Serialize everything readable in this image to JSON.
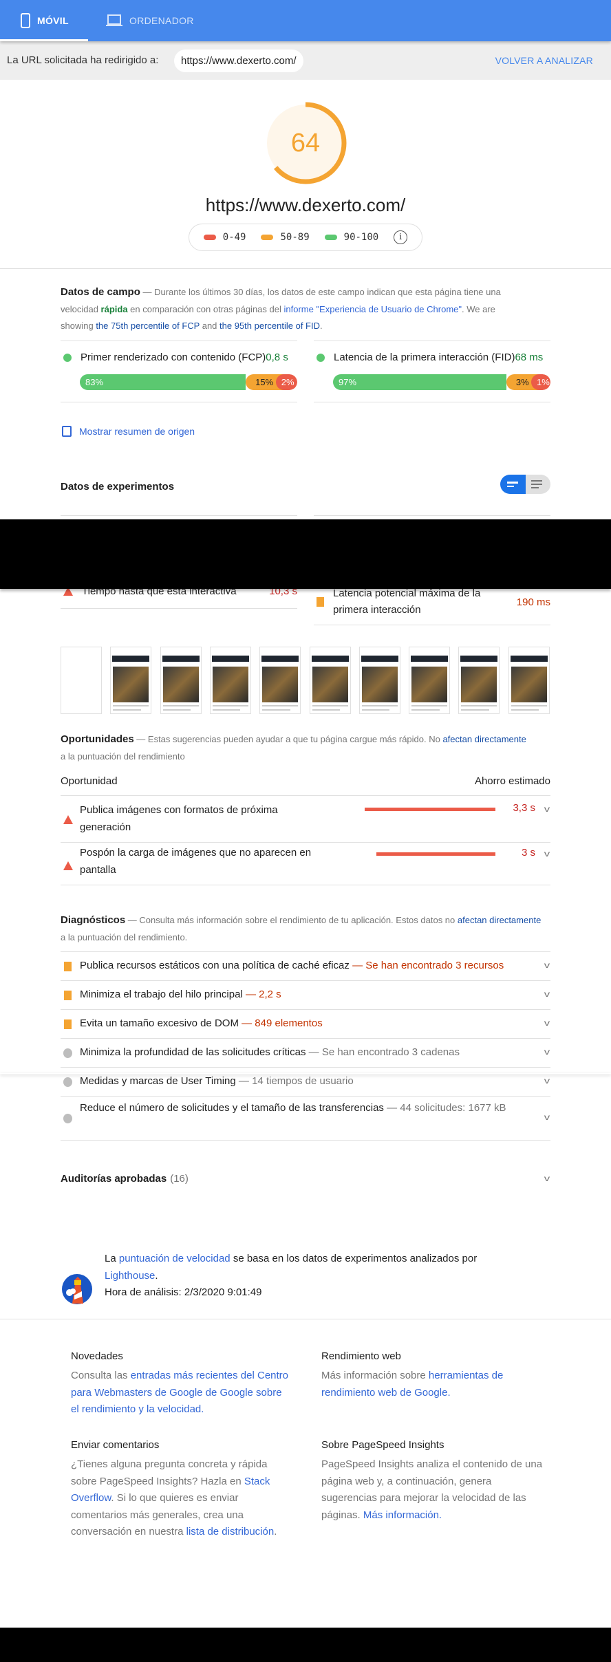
{
  "tabs": [
    {
      "label": "MÓVIL",
      "icon": "phone-icon",
      "active": true
    },
    {
      "label": "ORDENADOR",
      "icon": "laptop-icon",
      "active": false
    }
  ],
  "redirect": {
    "label": "La URL solicitada ha redirigido a:",
    "url": "https://www.dexerto.com/",
    "reanalyze": "VOLVER A ANALIZAR"
  },
  "score": {
    "value": "64",
    "fraction": 0.64,
    "color": "#f4a432",
    "url": "https://www.dexerto.com/"
  },
  "legend": [
    {
      "range": "0-49",
      "color": "#eb5b48"
    },
    {
      "range": "50-89",
      "color": "#f4a432"
    },
    {
      "range": "90-100",
      "color": "#5bc870"
    }
  ],
  "field": {
    "title": "Datos de campo",
    "desc_1": " — Durante los últimos 30 días, los datos de este campo indican que esta página tiene una velocidad ",
    "speed": "rápida",
    "desc_2": " en comparación con otras páginas del ",
    "report_link": "informe \"Experiencia de Usuario de Chrome\"",
    "desc_3": ". We are showing ",
    "fcp_link": "the 75th percentile of FCP",
    "desc_4": " and ",
    "fid_link": "the 95th percentile of FID",
    "desc_5": ".",
    "metrics": [
      {
        "name": "Primer renderizado con contenido (FCP)",
        "value": "0,8 s",
        "dist": [
          {
            "label": "83%",
            "pct": 83
          },
          {
            "label": "15%",
            "pct": 15
          },
          {
            "label": "2%",
            "pct": 2
          }
        ]
      },
      {
        "name": "Latencia de la primera interacción (FID)",
        "value": "68 ms",
        "dist": [
          {
            "label": "97%",
            "pct": 97
          },
          {
            "label": "3%",
            "pct": 3
          },
          {
            "label": "1%",
            "pct": 1
          }
        ]
      }
    ],
    "origin_checkbox": "Mostrar resumen de origen"
  },
  "lab": {
    "title": "Datos de experimentos",
    "metrics": [
      {
        "name": "Tiempo hasta que está interactiva",
        "value": "10,3 s"
      },
      {
        "name": "Latencia potencial máxima de la primera interacción",
        "value": "190 ms"
      }
    ]
  },
  "opportunities": {
    "title": "Oportunidades",
    "desc_1": " — Estas sugerencias pueden ayudar a que tu página cargue más rápido. No ",
    "link": "afectan directamente",
    "desc_2": " a la puntuación del rendimiento",
    "col_left": "Oportunidad",
    "col_right": "Ahorro estimado",
    "items": [
      {
        "title": "Publica imágenes con formatos de próxima generación",
        "saving": "3,3 s",
        "bar_fraction": 1.0
      },
      {
        "title": "Pospón la carga de imágenes que no aparecen en pantalla",
        "saving": "3 s",
        "bar_fraction": 0.91
      }
    ]
  },
  "diagnostics": {
    "title": "Diagnósticos",
    "desc_1": " — Consulta más información sobre el rendimiento de tu aplicación. Estos datos no ",
    "link": "afectan directamente",
    "desc_2": " a la puntuación del rendimiento.",
    "items": [
      {
        "title": "Publica recursos estáticos con una política de caché eficaz",
        "detail": "— Se han encontrado 3 recursos",
        "level": "average"
      },
      {
        "title": "Minimiza el trabajo del hilo principal",
        "detail": "— 2,2 s",
        "level": "average"
      },
      {
        "title": "Evita un tamaño excesivo de DOM",
        "detail": "— 849 elementos",
        "level": "average"
      },
      {
        "title": "Minimiza la profundidad de las solicitudes críticas",
        "detail": "— Se han encontrado 3 cadenas",
        "level": "info"
      },
      {
        "title": "Medidas y marcas de User Timing",
        "detail": "— 14 tiempos de usuario",
        "level": "info"
      },
      {
        "title": "Reduce el número de solicitudes y el tamaño de las transferencias",
        "detail": "— 44 solicitudes: 1677 kB",
        "level": "info"
      }
    ]
  },
  "passed": {
    "title": "Auditorías aprobadas",
    "count": "(16)"
  },
  "lighthouse": {
    "pre": "La ",
    "link": "puntuación de velocidad",
    "mid": " se basa en los datos de experimentos analizados por ",
    "lh": "Lighthouse",
    "post": ".",
    "time": "Hora de análisis: 2/3/2020 9:01:49"
  },
  "footer": {
    "news": {
      "title": "Novedades",
      "pre": "Consulta las ",
      "link": "entradas más recientes del Centro para Webmasters de Google de Google sobre el rendimiento y la velocidad."
    },
    "web": {
      "title": "Rendimiento web",
      "pre": "Más información sobre ",
      "link": "herramientas de rendimiento web de Google."
    },
    "feedback": {
      "title": "Enviar comentarios",
      "pre": "¿Tienes alguna pregunta concreta y rápida sobre PageSpeed Insights? Hazla en ",
      "link1": "Stack Overflow",
      "mid": ". Si lo que quieres es enviar comentarios más generales, crea una conversación en nuestra ",
      "link2": "lista de distribución",
      "post": "."
    },
    "about": {
      "title": "Sobre PageSpeed Insights",
      "pre": "PageSpeed Insights analiza el contenido de una página web y, a continuación, genera sugerencias para mejorar la velocidad de las páginas. ",
      "link": "Más información."
    }
  }
}
